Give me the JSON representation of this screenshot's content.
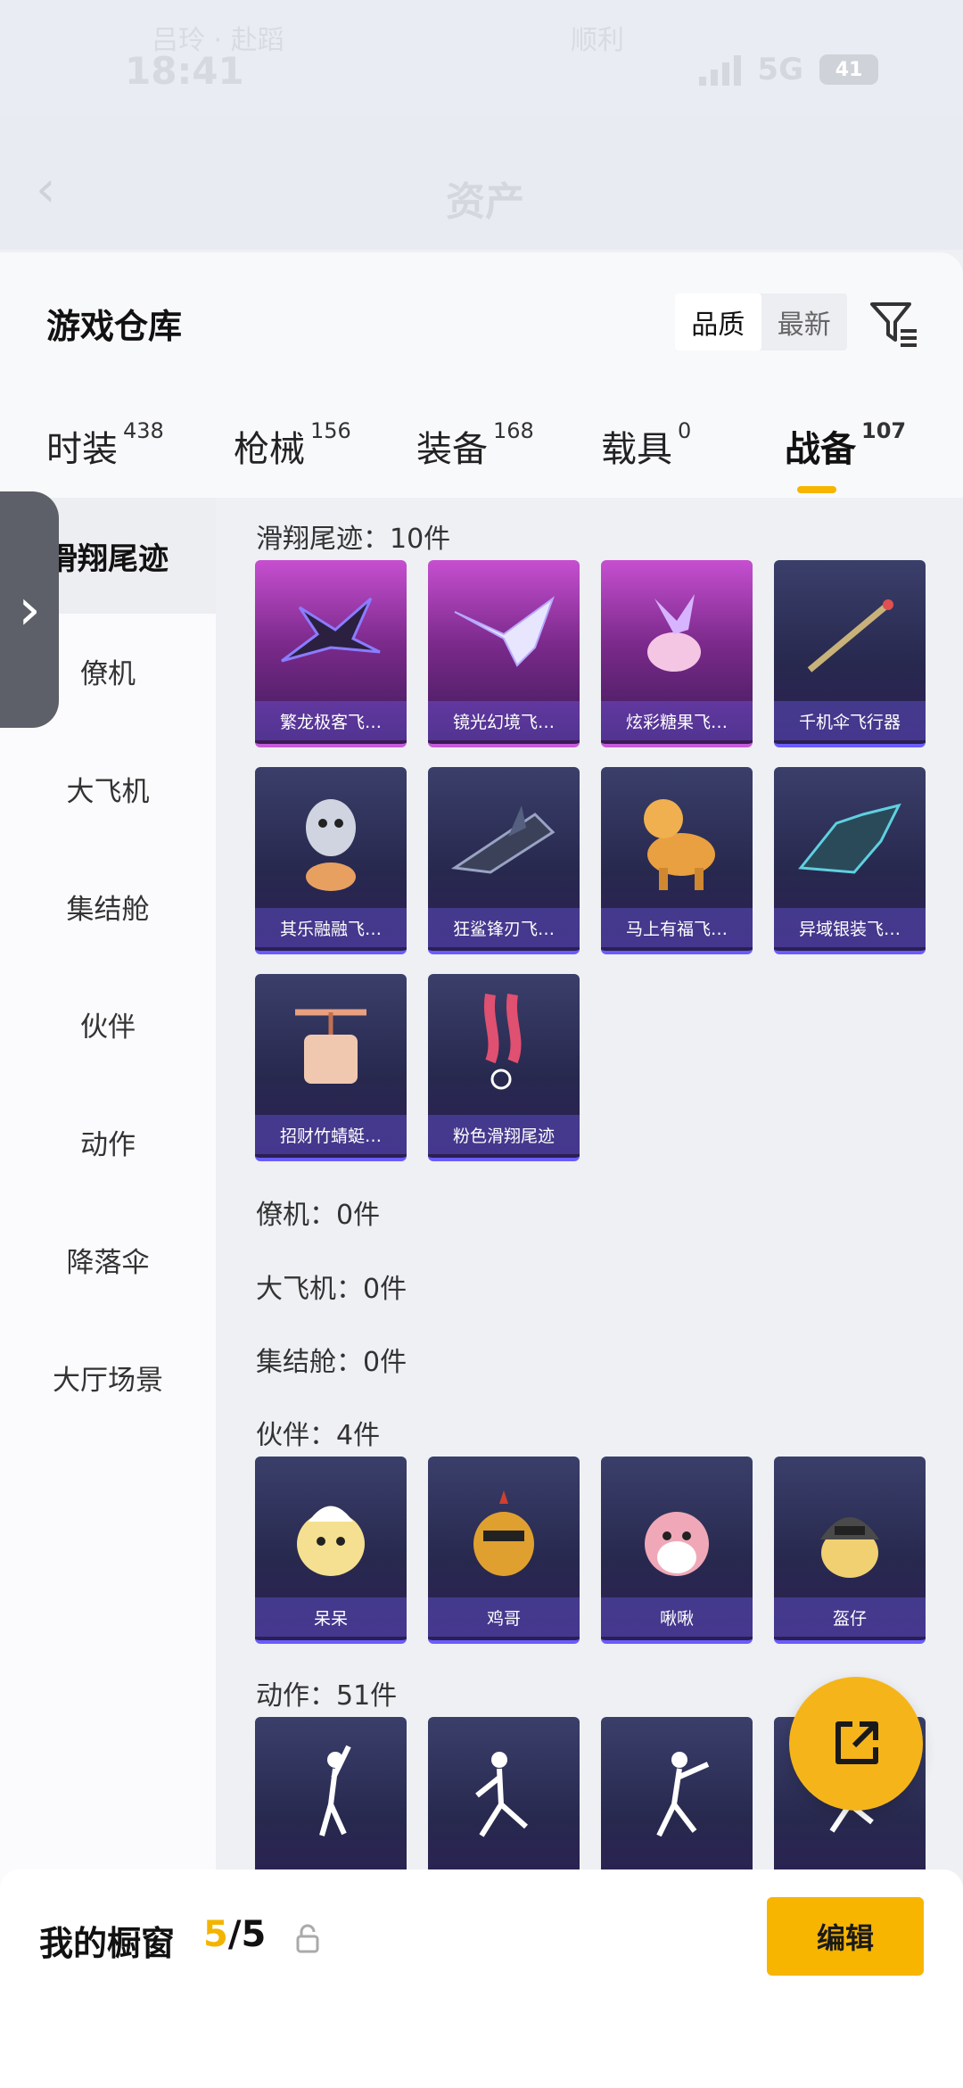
{
  "status_bar": {
    "time": "18:41",
    "faint_left": "吕玲 · 赴蹈",
    "faint_center": "顺利",
    "network": "5G",
    "battery": "41"
  },
  "nav": {
    "title": "资产"
  },
  "panel": {
    "title": "游戏仓库",
    "sort_options": [
      "品质",
      "最新"
    ],
    "sort_selected": "品质"
  },
  "tabs": [
    {
      "label": "时装",
      "count": "438"
    },
    {
      "label": "枪械",
      "count": "156"
    },
    {
      "label": "装备",
      "count": "168"
    },
    {
      "label": "载具",
      "count": "0"
    },
    {
      "label": "战备",
      "count": "107"
    }
  ],
  "active_tab": "战备",
  "categories": [
    "滑翔尾迹",
    "僚机",
    "大飞机",
    "集结舱",
    "伙伴",
    "动作",
    "降落伞",
    "大厅场景"
  ],
  "sections": {
    "glide": {
      "title": "滑翔尾迹：10件",
      "items": [
        {
          "name": "繁龙极客飞…"
        },
        {
          "name": "镜光幻境飞…"
        },
        {
          "name": "炫彩糖果飞…"
        },
        {
          "name": "千机伞飞行器"
        },
        {
          "name": "其乐融融飞…"
        },
        {
          "name": "狂鲨锋刃飞…"
        },
        {
          "name": "马上有福飞…"
        },
        {
          "name": "异域银装飞…"
        },
        {
          "name": "招财竹蜻蜓…"
        },
        {
          "name": "粉色滑翔尾迹"
        }
      ]
    },
    "wingman": {
      "title": "僚机：0件"
    },
    "plane": {
      "title": "大飞机：0件"
    },
    "pod": {
      "title": "集结舱：0件"
    },
    "partner": {
      "title": "伙伴：4件",
      "items": [
        {
          "name": "呆呆"
        },
        {
          "name": "鸡哥"
        },
        {
          "name": "啾啾"
        },
        {
          "name": "盔仔"
        }
      ]
    },
    "emote": {
      "title": "动作：51件"
    }
  },
  "bottom": {
    "title": "我的橱窗",
    "current": "5",
    "total": "/5",
    "edit_label": "编辑"
  },
  "colors": {
    "accent": "#f7b500",
    "card_bg": "#2a2d5a",
    "card_purple": "#9a3aa8"
  }
}
